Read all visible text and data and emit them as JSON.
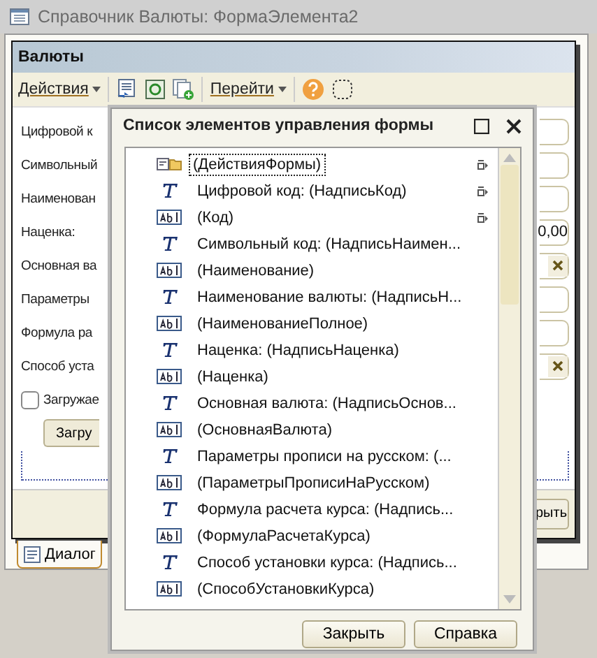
{
  "window": {
    "title": "Справочник Валюты: ФормаЭлемента2"
  },
  "form": {
    "title": "Валюты",
    "toolbar": [
      {
        "kind": "menu",
        "label": "Действия"
      },
      {
        "kind": "list"
      },
      {
        "kind": "refresh"
      },
      {
        "kind": "copy"
      },
      {
        "kind": "menu",
        "label": "Перейти"
      },
      {
        "kind": "help"
      },
      {
        "kind": "frame"
      }
    ],
    "rows": [
      {
        "label": "Цифровой к",
        "kind": "text",
        "value": ""
      },
      {
        "label": "Символьный",
        "kind": "text",
        "value": ""
      },
      {
        "label": "Наименован",
        "kind": "text",
        "value": ""
      },
      {
        "label": "Наценка:",
        "kind": "text",
        "value": "0,00"
      },
      {
        "label": "Основная ва",
        "kind": "select",
        "value": ""
      },
      {
        "label": "Параметры",
        "kind": "text",
        "value": ""
      },
      {
        "label": "Формула ра",
        "kind": "text",
        "value": ""
      },
      {
        "label": "Способ уста",
        "kind": "select",
        "value": ""
      }
    ],
    "checkbox": {
      "label": "Загружае",
      "checked": false
    },
    "load_button": "Загру",
    "close_button": "рыть"
  },
  "tabs": [
    {
      "label": "Диалог",
      "selected": true
    }
  ],
  "dialog": {
    "title": "Список элементов управления формы",
    "items": [
      {
        "kind": "group",
        "text": "(ДействияФормы)",
        "selected": true,
        "linked": true
      },
      {
        "kind": "label",
        "text": "Цифровой код: (НадписьКод)",
        "selected": false,
        "linked": true
      },
      {
        "kind": "field",
        "text": "(Код)",
        "selected": false,
        "linked": true
      },
      {
        "kind": "label",
        "text": "Символьный код: (НадписьНаимен...",
        "selected": false,
        "linked": false
      },
      {
        "kind": "field",
        "text": "(Наименование)",
        "selected": false,
        "linked": false
      },
      {
        "kind": "label",
        "text": "Наименование валюты: (НадписьН...",
        "selected": false,
        "linked": false
      },
      {
        "kind": "field",
        "text": "(НаименованиеПолное)",
        "selected": false,
        "linked": false
      },
      {
        "kind": "label",
        "text": "Наценка: (НадписьНаценка)",
        "selected": false,
        "linked": false
      },
      {
        "kind": "field",
        "text": "(Наценка)",
        "selected": false,
        "linked": false
      },
      {
        "kind": "label",
        "text": "Основная валюта: (НадписьОснов...",
        "selected": false,
        "linked": false
      },
      {
        "kind": "field",
        "text": "(ОсновнаяВалюта)",
        "selected": false,
        "linked": false
      },
      {
        "kind": "label",
        "text": "Параметры прописи на русском: (...",
        "selected": false,
        "linked": false
      },
      {
        "kind": "field",
        "text": "(ПараметрыПрописиНаРусском)",
        "selected": false,
        "linked": false
      },
      {
        "kind": "label",
        "text": "Формула расчета курса: (Надпись...",
        "selected": false,
        "linked": false
      },
      {
        "kind": "field",
        "text": "(ФормулаРасчетаКурса)",
        "selected": false,
        "linked": false
      },
      {
        "kind": "label",
        "text": "Способ установки курса: (Надпись...",
        "selected": false,
        "linked": false
      },
      {
        "kind": "field",
        "text": "(СпособУстановкиКурса)",
        "selected": false,
        "linked": false
      }
    ],
    "buttons": [
      "Закрыть",
      "Справка"
    ]
  }
}
